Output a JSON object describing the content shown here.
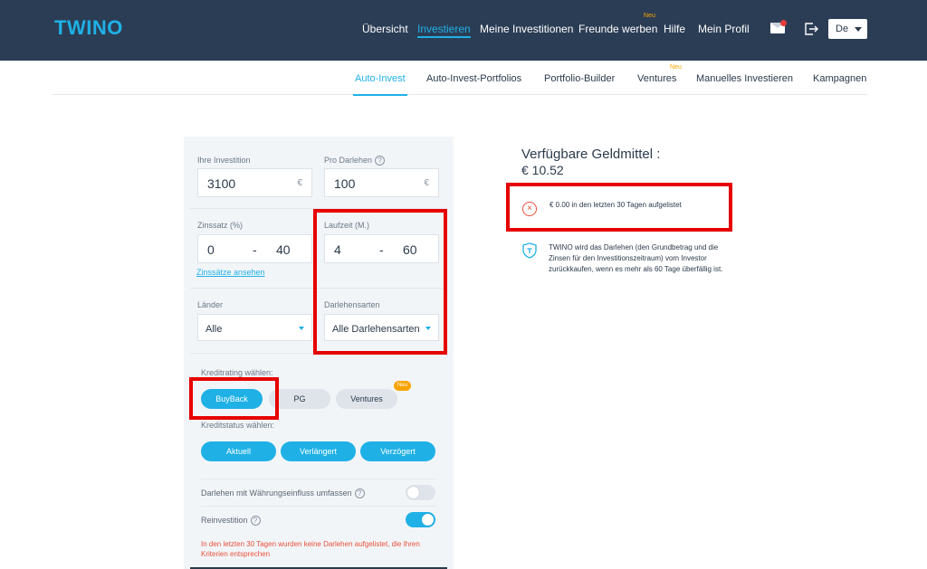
{
  "header": {
    "logo": "TWINO",
    "nav": [
      {
        "label": "Übersicht",
        "active": false
      },
      {
        "label": "Investieren",
        "active": true
      },
      {
        "label": "Meine Investitionen",
        "active": false
      },
      {
        "label": "Freunde werben",
        "active": false,
        "badge": "Neu"
      },
      {
        "label": "Hilfe",
        "active": false
      },
      {
        "label": "Mein Profil",
        "active": false
      }
    ],
    "language": "De"
  },
  "subnav": {
    "items": [
      {
        "label": "Auto-Invest",
        "active": true
      },
      {
        "label": "Auto-Invest-Portfolios",
        "active": false
      },
      {
        "label": "Portfolio-Builder",
        "active": false
      },
      {
        "label": "Ventures",
        "active": false,
        "badge": "Neu"
      },
      {
        "label": "Manuelles Investieren",
        "active": false
      },
      {
        "label": "Kampagnen",
        "active": false
      }
    ]
  },
  "form": {
    "investment_label": "Ihre Investition",
    "investment_value": "3100",
    "per_loan_label": "Pro Darlehen",
    "per_loan_value": "100",
    "currency": "€",
    "help": "?",
    "interest_label": "Zinssatz (%)",
    "interest_from": "0",
    "interest_to": "40",
    "dash": "-",
    "interest_link": "Zinssätze ansehen",
    "term_label": "Laufzeit (M.)",
    "term_from": "4",
    "term_to": "60",
    "countries_label": "Länder",
    "countries_value": "Alle",
    "loan_types_label": "Darlehensarten",
    "loan_types_value": "Alle Darlehensarten",
    "rating_label": "Kreditrating wählen:",
    "rating_options": [
      {
        "label": "BuyBack",
        "selected": true
      },
      {
        "label": "PG",
        "selected": false
      },
      {
        "label": "Ventures",
        "selected": false,
        "badge": "Neu"
      }
    ],
    "status_label": "Kreditstatus wählen:",
    "status_options": [
      {
        "label": "Aktuell",
        "selected": true
      },
      {
        "label": "Verlängert",
        "selected": true
      },
      {
        "label": "Verzögert",
        "selected": true
      }
    ],
    "currency_impact_label": "Darlehen mit Währungseinfluss umfassen",
    "currency_impact_on": false,
    "reinvest_label": "Reinvestition",
    "reinvest_on": true,
    "warning": "In den letzten 30 Tagen wurden keine Darlehen aufgelistet, die Ihren Kriterien entsprechen"
  },
  "info": {
    "funds_title": "Verfügbare Geldmittel :",
    "funds_value": "€ 10.52",
    "listed_text": "€ 0.00 in den letzten 30 Tagen aufgelistet",
    "buyback_text": "TWINO wird das Darlehen (den Grundbetrag und die Zinsen für den Investitionszeitraum) vom Investor zurückkaufen, wenn es mehr als 60 Tage überfällig ist."
  },
  "colors": {
    "header_bg": "#2b3d55",
    "accent": "#1fb1e6",
    "badge": "#f7a400",
    "warning": "#e8503a",
    "highlight": "#e60000"
  }
}
